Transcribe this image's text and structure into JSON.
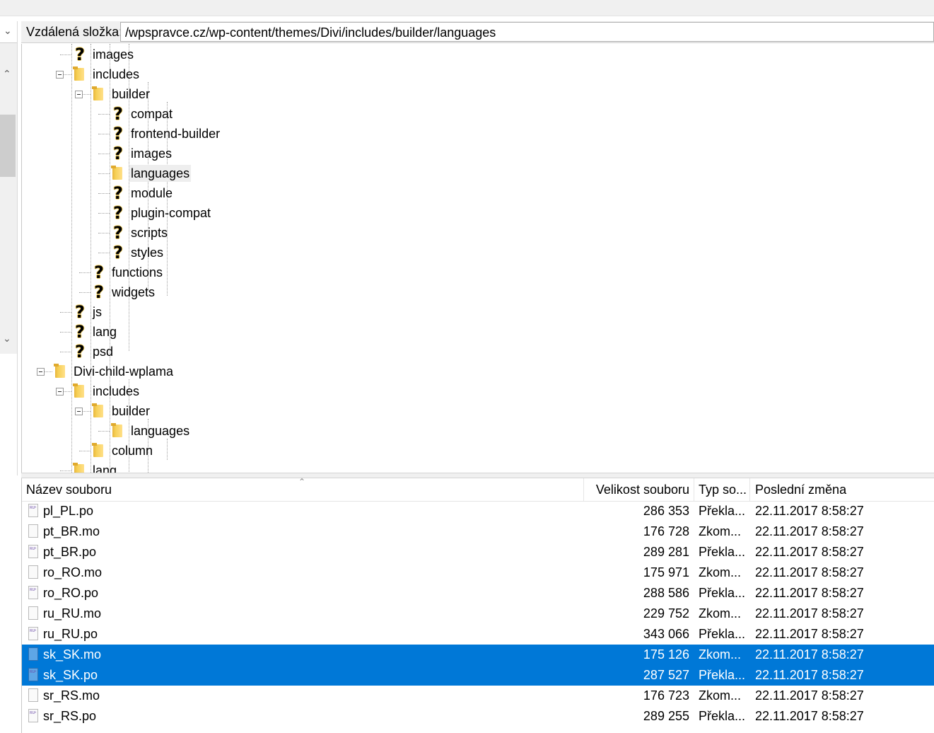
{
  "remote": {
    "label": "Vzdálená složka:",
    "path": "/wpspravce.cz/wp-content/themes/Divi/includes/builder/languages"
  },
  "tree": [
    {
      "label": "images",
      "icon": "question-icon"
    },
    {
      "label": "includes",
      "icon": "folder-icon"
    },
    {
      "label": "builder",
      "icon": "folder-icon"
    },
    {
      "label": "compat",
      "icon": "question-icon"
    },
    {
      "label": "frontend-builder",
      "icon": "question-icon"
    },
    {
      "label": "images",
      "icon": "question-icon"
    },
    {
      "label": "languages",
      "icon": "folder-icon",
      "selected": true
    },
    {
      "label": "module",
      "icon": "question-icon"
    },
    {
      "label": "plugin-compat",
      "icon": "question-icon"
    },
    {
      "label": "scripts",
      "icon": "question-icon"
    },
    {
      "label": "styles",
      "icon": "question-icon"
    },
    {
      "label": "functions",
      "icon": "question-icon"
    },
    {
      "label": "widgets",
      "icon": "question-icon"
    },
    {
      "label": "js",
      "icon": "question-icon"
    },
    {
      "label": "lang",
      "icon": "question-icon"
    },
    {
      "label": "psd",
      "icon": "question-icon"
    },
    {
      "label": "Divi-child-wplama",
      "icon": "folder-icon"
    },
    {
      "label": "includes",
      "icon": "folder-icon"
    },
    {
      "label": "builder",
      "icon": "folder-icon"
    },
    {
      "label": "languages",
      "icon": "folder-icon"
    },
    {
      "label": "column",
      "icon": "folder-icon"
    },
    {
      "label": "lang",
      "icon": "folder-icon"
    }
  ],
  "columns": {
    "name": "Název souboru",
    "size": "Velikost souboru",
    "type": "Typ so...",
    "modified": "Poslední změna"
  },
  "files": [
    {
      "name": "pl_PL.po",
      "size": "286 353",
      "type": "Překla...",
      "modified": "22.11.2017 8:58:27",
      "kind": "po"
    },
    {
      "name": "pt_BR.mo",
      "size": "176 728",
      "type": "Zkom...",
      "modified": "22.11.2017 8:58:27",
      "kind": "mo"
    },
    {
      "name": "pt_BR.po",
      "size": "289 281",
      "type": "Překla...",
      "modified": "22.11.2017 8:58:27",
      "kind": "po"
    },
    {
      "name": "ro_RO.mo",
      "size": "175 971",
      "type": "Zkom...",
      "modified": "22.11.2017 8:58:27",
      "kind": "mo"
    },
    {
      "name": "ro_RO.po",
      "size": "288 586",
      "type": "Překla...",
      "modified": "22.11.2017 8:58:27",
      "kind": "po"
    },
    {
      "name": "ru_RU.mo",
      "size": "229 752",
      "type": "Zkom...",
      "modified": "22.11.2017 8:58:27",
      "kind": "mo"
    },
    {
      "name": "ru_RU.po",
      "size": "343 066",
      "type": "Překla...",
      "modified": "22.11.2017 8:58:27",
      "kind": "po"
    },
    {
      "name": "sk_SK.mo",
      "size": "175 126",
      "type": "Zkom...",
      "modified": "22.11.2017 8:58:27",
      "kind": "mo",
      "selected": true
    },
    {
      "name": "sk_SK.po",
      "size": "287 527",
      "type": "Překla...",
      "modified": "22.11.2017 8:58:27",
      "kind": "po",
      "selected": true
    },
    {
      "name": "sr_RS.mo",
      "size": "176 723",
      "type": "Zkom...",
      "modified": "22.11.2017 8:58:27",
      "kind": "mo"
    },
    {
      "name": "sr_RS.po",
      "size": "289 255",
      "type": "Překla...",
      "modified": "22.11.2017 8:58:27",
      "kind": "po"
    }
  ],
  "colors": {
    "selection": "#0078d7",
    "folder": "#f6cf55"
  }
}
